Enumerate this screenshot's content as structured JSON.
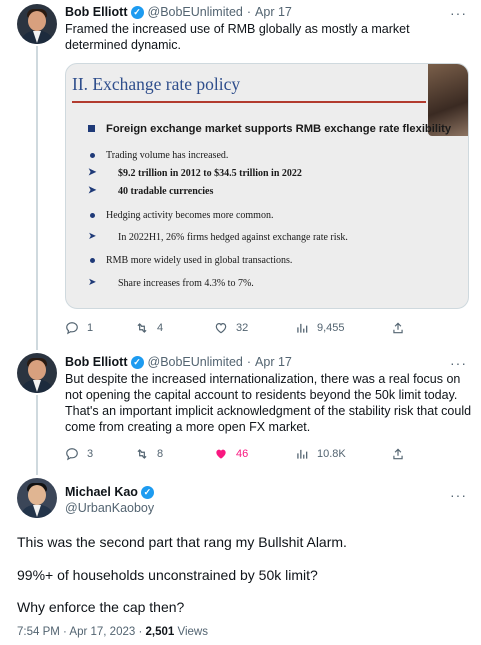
{
  "tweets": [
    {
      "name": "Bob Elliott",
      "handle": "@BobEUnlimited",
      "sep": "·",
      "date": "Apr 17",
      "text": "Framed the increased use of RMB globally as mostly a market determined dynamic.",
      "actions": {
        "replies": "1",
        "retweets": "4",
        "likes": "32",
        "views": "9,455"
      }
    },
    {
      "name": "Bob Elliott",
      "handle": "@BobEUnlimited",
      "sep": "·",
      "date": "Apr 17",
      "text": "But despite the increased internationalization, there was a real focus on not opening the capital account to residents beyond the 50k limit today. That's an important implicit acknowledgment of the stability risk that could come from creating a more open FX market.",
      "actions": {
        "replies": "3",
        "retweets": "8",
        "likes": "46",
        "views": "10.8K"
      }
    }
  ],
  "slide": {
    "title": "II. Exchange rate policy",
    "lines": [
      "Foreign exchange market supports RMB exchange rate flexibility",
      "Trading volume has increased.",
      "$9.2 trillion in 2012 to $34.5 trillion in 2022",
      "40 tradable currencies",
      "Hedging activity becomes more common.",
      "In 2022H1, 26% firms hedged against exchange rate risk.",
      "RMB more widely used in global transactions.",
      "Share increases from 4.3% to 7%."
    ]
  },
  "main_tweet": {
    "name": "Michael Kao",
    "handle": "@UrbanKaoboy",
    "paragraphs": [
      "This was the second part that rang my Bullshit Alarm.",
      "99%+ of households unconstrained by 50k limit?",
      "Why enforce the cap then?"
    ],
    "timestamp": "7:54 PM · Apr 17, 2023 · ",
    "views_count": "2,501",
    "views_label": "Views"
  },
  "icons": {
    "reply": "reply-icon",
    "retweet": "retweet-icon",
    "like": "heart-icon",
    "views": "views-icon",
    "share": "share-icon",
    "verified": "verified-badge-icon",
    "more": "more-icon"
  },
  "colors": {
    "like_active": "#f91880",
    "verified": "#1d9bf0",
    "secondary_text": "#536471"
  }
}
